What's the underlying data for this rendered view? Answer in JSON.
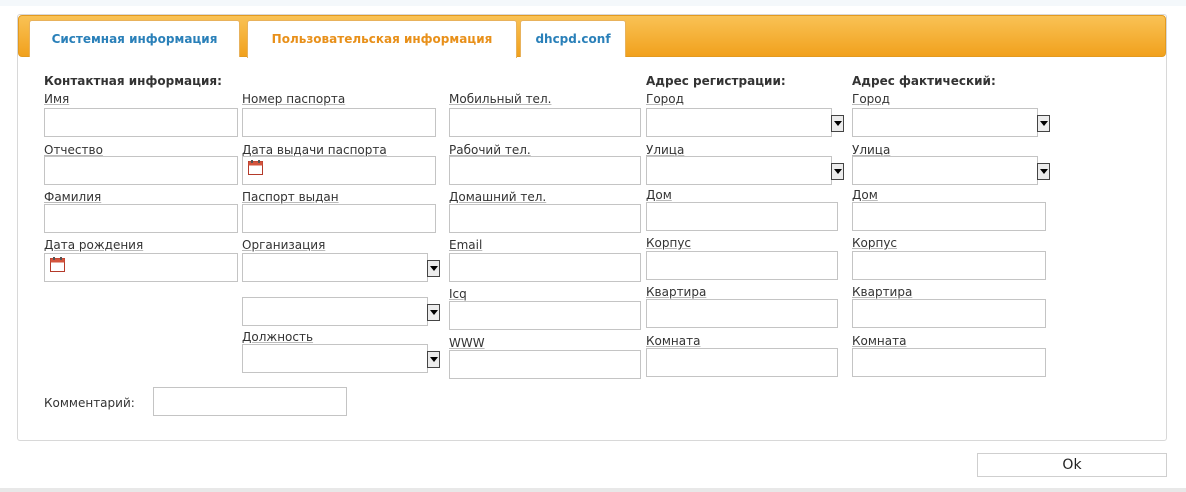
{
  "tabs": [
    {
      "label": "Системная информация"
    },
    {
      "label": "Пользовательская информация"
    },
    {
      "label": "dhcpd.conf"
    }
  ],
  "contact": {
    "heading": "Контактная информация:",
    "first_name_label": "Имя",
    "middle_name_label": "Отчество",
    "last_name_label": "Фамилия",
    "birth_date_label": "Дата рождения"
  },
  "passport": {
    "number_label": "Номер паспорта",
    "issue_date_label": "Дата выдачи паспорта",
    "issued_by_label": "Паспорт выдан",
    "organization_label": "Организация",
    "position_label": "Должность"
  },
  "phones": {
    "mobile_label": "Мобильный тел.",
    "work_label": "Рабочий тел.",
    "home_label": "Домашний тел.",
    "email_label": "Email",
    "icq_label": "Icq",
    "www_label": "WWW"
  },
  "reg_address": {
    "heading": "Адрес регистрации:",
    "city_label": "Город",
    "street_label": "Улица",
    "house_label": "Дом",
    "building_label": "Корпус",
    "apartment_label": "Квартира",
    "room_label": "Комната"
  },
  "fact_address": {
    "heading": "Адрес фактический:",
    "city_label": "Город",
    "street_label": "Улица",
    "house_label": "Дом",
    "building_label": "Корпус",
    "apartment_label": "Квартира",
    "room_label": "Комната"
  },
  "comment_label": "Комментарий:",
  "ok_label": "Ok",
  "colors": {
    "tabbar": "#f1a11d",
    "tab_text": "#2a80b9",
    "tab_active_text": "#e8901a"
  },
  "icons": {
    "calendar": "calendar-icon",
    "dropdown": "chevron-down-icon"
  }
}
